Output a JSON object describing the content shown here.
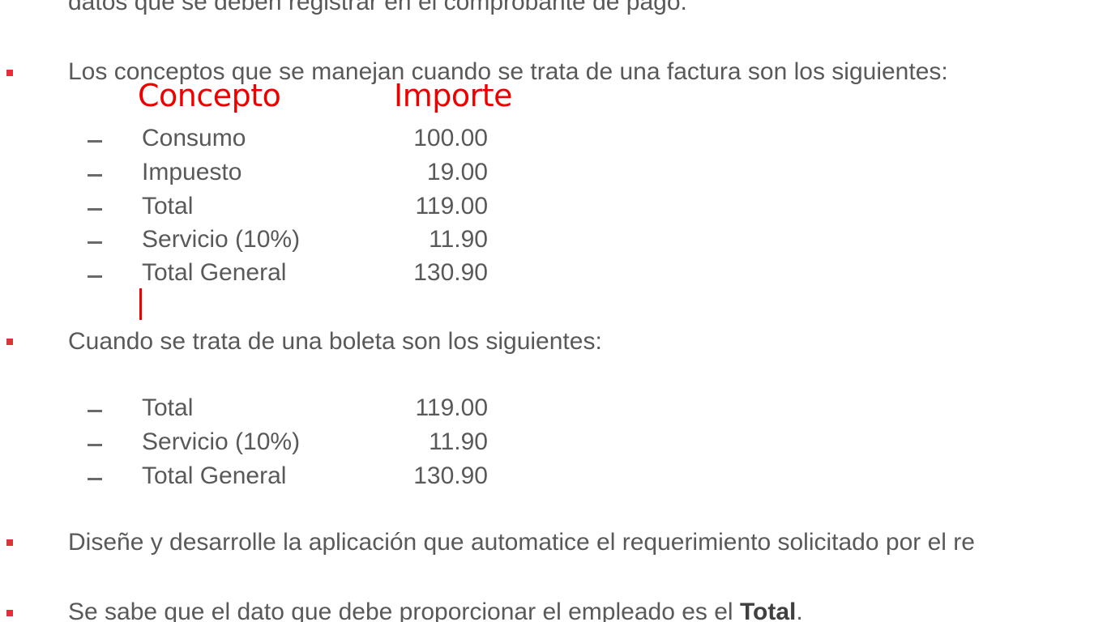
{
  "doc": {
    "top_line": "datos que se deben registrar en el comprobante de pago.",
    "bullet_factura": "Los conceptos que se manejan cuando se trata de una factura son los siguientes:",
    "bullet_boleta": "Cuando se trata de una boleta son los siguientes:",
    "bullet_disene": "Diseñe y desarrolle la aplicación que automatice el requerimiento solicitado por el re",
    "bullet_sabe_prefix": "Se sabe que el dato que debe proporcionar el empleado es el ",
    "bullet_sabe_bold": "Total",
    "bullet_sabe_suffix": "."
  },
  "annotations": {
    "concepto": "Concepto",
    "importe": "Importe"
  },
  "factura_rows": [
    {
      "concept": "Consumo",
      "amount": "100.00"
    },
    {
      "concept": "Impuesto",
      "amount": "19.00"
    },
    {
      "concept": "Total",
      "amount": "119.00"
    },
    {
      "concept": "Servicio (10%)",
      "amount": "11.90"
    },
    {
      "concept": "Total General",
      "amount": "130.90"
    }
  ],
  "boleta_rows": [
    {
      "concept": "Total",
      "amount": "119.00"
    },
    {
      "concept": "Servicio (10%)",
      "amount": "11.90"
    },
    {
      "concept": "Total General",
      "amount": "130.90"
    }
  ],
  "colors": {
    "bullet": "#e0303a",
    "annotation": "#ee0000",
    "text": "#595959"
  }
}
